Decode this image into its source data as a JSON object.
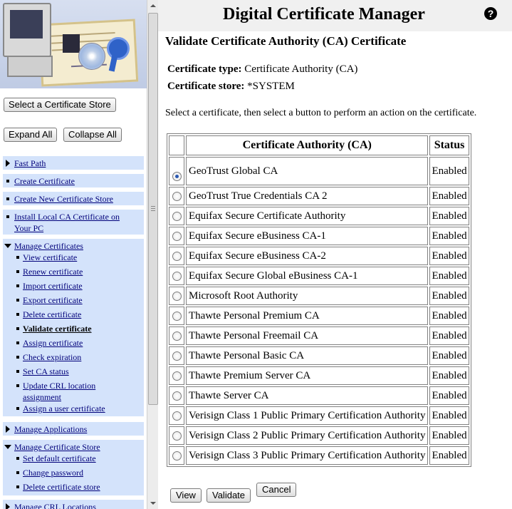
{
  "nav": {
    "select_store_label": "Select a Certificate Store",
    "expand_all_label": "Expand All",
    "collapse_all_label": "Collapse All",
    "fast_path": "Fast Path",
    "create_certificate": "Create Certificate",
    "create_new_store": "Create New Certificate Store",
    "install_local_ca": [
      "Install Local CA Certificate on",
      "Your PC"
    ],
    "manage_certificates": {
      "label": "Manage Certificates",
      "items": [
        "View certificate",
        "Renew certificate",
        "Import certificate",
        "Export certificate",
        "Delete certificate",
        "Validate certificate",
        "Assign certificate",
        "Check expiration",
        "Set CA status",
        "Update CRL location",
        "assignment",
        "Assign a user certificate"
      ]
    },
    "manage_applications": "Manage Applications",
    "manage_store": {
      "label": "Manage Certificate Store",
      "items": [
        "Set default certificate",
        "Change password",
        "Delete certificate store"
      ]
    },
    "manage_crl_partial": "Manage CRL Locations"
  },
  "header": {
    "app_title": "Digital Certificate Manager",
    "help_glyph": "?"
  },
  "page": {
    "title": "Validate Certificate Authority (CA) Certificate",
    "cert_type_label": "Certificate type:",
    "cert_type_value": "Certificate Authority (CA)",
    "cert_store_label": "Certificate store:",
    "cert_store_value": "*SYSTEM",
    "instructions": "Select a certificate, then select a button to perform an action on the certificate."
  },
  "table": {
    "col_ca": "Certificate Authority (CA)",
    "col_status": "Status",
    "rows": [
      {
        "name": "GeoTrust Global CA",
        "status": "Enabled",
        "selected": true
      },
      {
        "name": "GeoTrust True Credentials CA 2",
        "status": "Enabled"
      },
      {
        "name": "Equifax Secure Certificate Authority",
        "status": "Enabled"
      },
      {
        "name": "Equifax Secure eBusiness CA-1",
        "status": "Enabled"
      },
      {
        "name": "Equifax Secure eBusiness CA-2",
        "status": "Enabled"
      },
      {
        "name": "Equifax Secure Global eBusiness CA-1",
        "status": "Enabled"
      },
      {
        "name": "Microsoft Root Authority",
        "status": "Enabled"
      },
      {
        "name": "Thawte Personal Premium CA",
        "status": "Enabled"
      },
      {
        "name": "Thawte Personal Freemail CA",
        "status": "Enabled"
      },
      {
        "name": "Thawte Personal Basic CA",
        "status": "Enabled"
      },
      {
        "name": "Thawte Premium Server CA",
        "status": "Enabled"
      },
      {
        "name": "Thawte Server CA",
        "status": "Enabled"
      },
      {
        "name": "Verisign Class 1 Public Primary Certification Authority",
        "status": "Enabled"
      },
      {
        "name": "Verisign Class 2 Public Primary Certification Authority",
        "status": "Enabled"
      },
      {
        "name": "Verisign Class 3 Public Primary Certification Authority",
        "status": "Enabled"
      }
    ]
  },
  "actions": {
    "view_label": "View",
    "validate_label": "Validate",
    "cancel_label": "Cancel"
  },
  "colors": {
    "nav_bg": "#d4e3fb",
    "link": "#00007a",
    "header_bg": "#f0f0f0"
  }
}
